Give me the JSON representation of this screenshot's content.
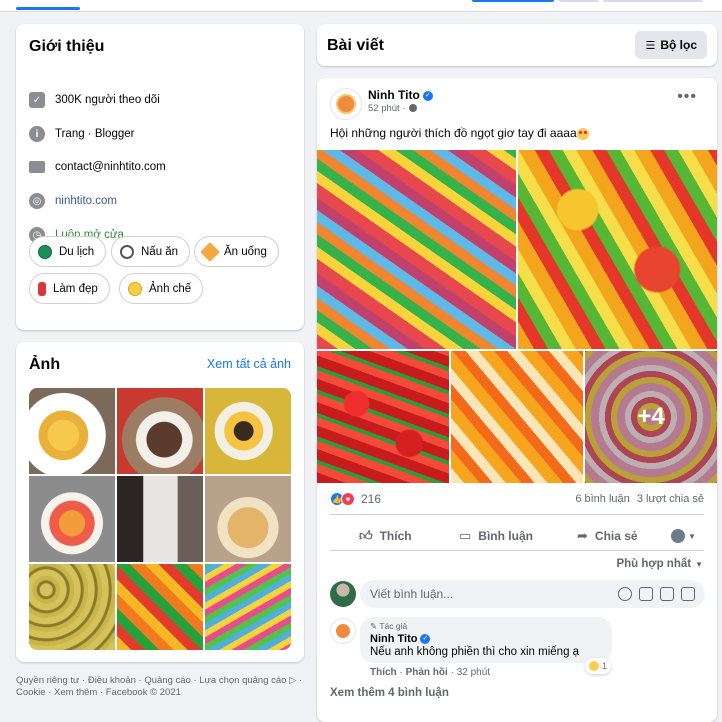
{
  "intro": {
    "title": "Giới thiệu",
    "followers": "300K người theo dõi",
    "category": "Trang · Blogger",
    "email": "contact@ninhtito.com",
    "website": "ninhtito.com",
    "hours": "Luôn mở cửa",
    "chips": [
      "Du lịch",
      "Nấu ăn",
      "Ăn uống",
      "Làm đẹp",
      "Ảnh chế"
    ],
    "icons": [
      "check-icon",
      "info-icon",
      "mail-icon",
      "globe-icon",
      "clock-icon"
    ]
  },
  "photos": {
    "title": "Ảnh",
    "see_all": "Xem tất cả ảnh"
  },
  "footer": {
    "line1": "Quyền riêng tư · Điều khoản · Quảng cáo · Lựa chọn quảng cáo ▷ ·",
    "line2": "Cookie · Xem thêm · Facebook © 2021"
  },
  "posts_header": {
    "title": "Bài viết",
    "filter": "Bộ lọc"
  },
  "post": {
    "author": "Ninh Tito",
    "time": "52 phút ·",
    "text": "Hội những người thích đồ ngọt giơ tay đi aaaa",
    "more_photos": "+4",
    "reaction_count": "216",
    "comments": "6 bình luận",
    "shares": "3 lượt chia sẻ",
    "like": "Thích",
    "comment": "Bình luận",
    "share": "Chia sẻ",
    "sort": "Phù hợp nhất",
    "comment_placeholder": "Viết bình luận...",
    "reply": {
      "tag": "Tác giả",
      "author": "Ninh Tito",
      "text": "Nếu anh không phiền thì cho xin miếng ạ",
      "reaction_count": "1",
      "like": "Thích",
      "reply": "Phản hồi",
      "time": "32 phút"
    },
    "see_more_comments": "Xem thêm 4 bình luận"
  },
  "colors": {
    "accent": "#1877f2",
    "link": "#385898",
    "open_status": "#2e8a3a"
  }
}
